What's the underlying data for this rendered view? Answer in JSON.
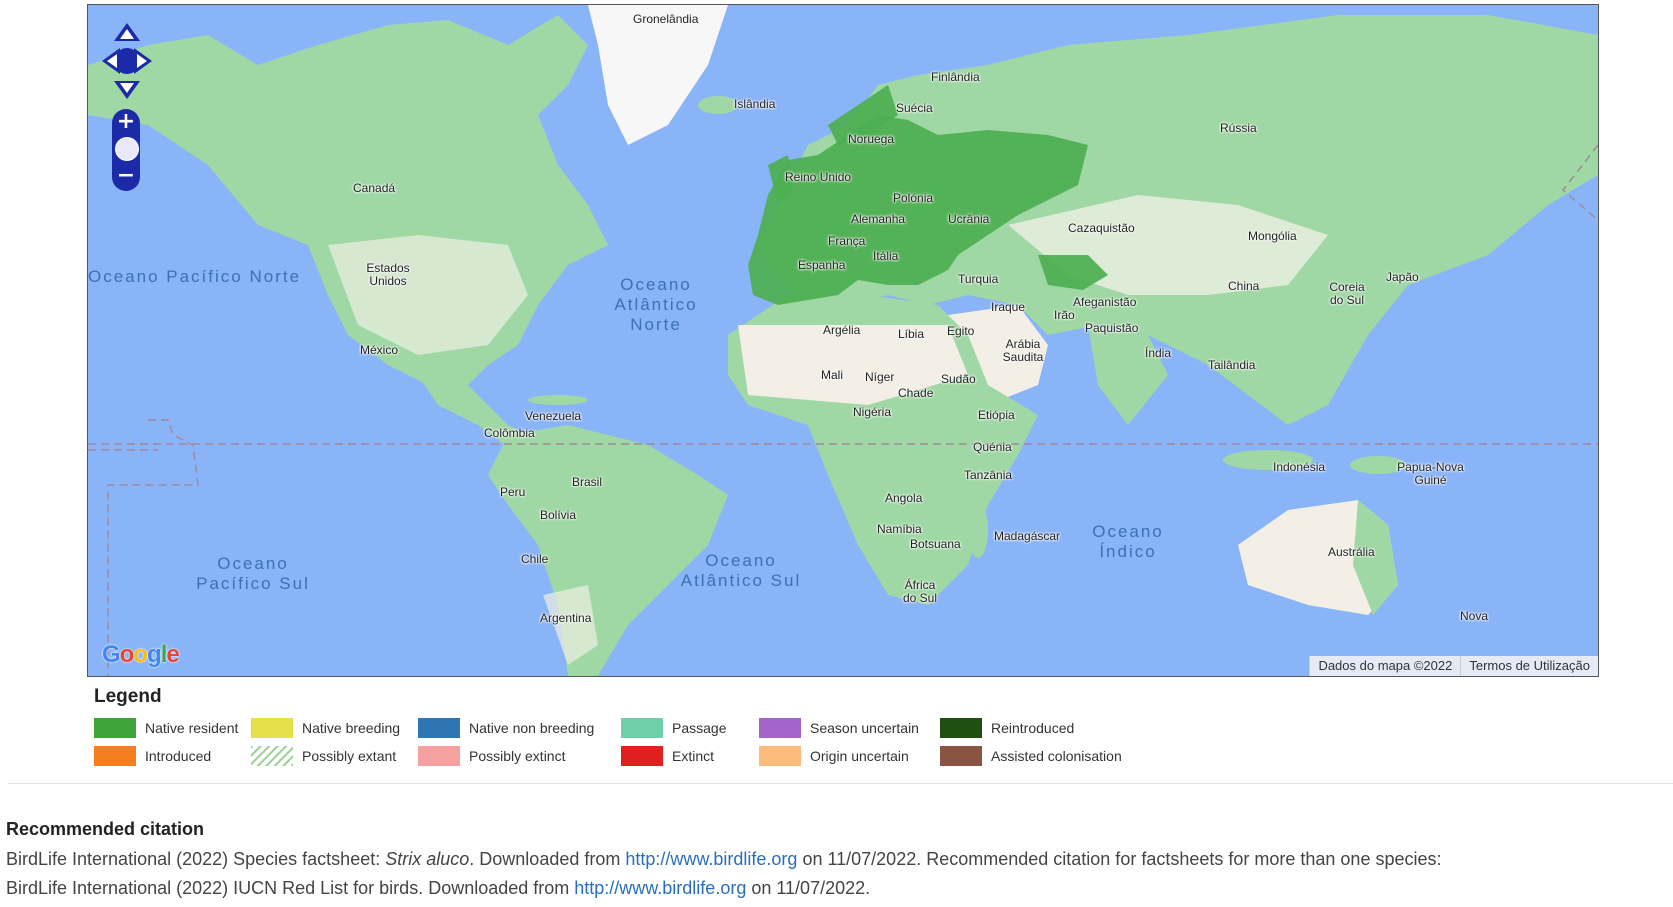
{
  "map": {
    "countries": [
      {
        "name": "Gronelândia"
      },
      {
        "name": "Islândia"
      },
      {
        "name": "Finlândia"
      },
      {
        "name": "Suécia"
      },
      {
        "name": "Noruega"
      },
      {
        "name": "Rússia"
      },
      {
        "name": "Reino Unido"
      },
      {
        "name": "Polónia"
      },
      {
        "name": "Alemanha"
      },
      {
        "name": "Ucrânia"
      },
      {
        "name": "França"
      },
      {
        "name": "Espanha"
      },
      {
        "name": "Itália"
      },
      {
        "name": "Turquia"
      },
      {
        "name": "Cazaquistão"
      },
      {
        "name": "Mongólia"
      },
      {
        "name": "Iraque"
      },
      {
        "name": "Irão"
      },
      {
        "name": "Afeganistão"
      },
      {
        "name": "Paquistão"
      },
      {
        "name": "China"
      },
      {
        "name": "Coreia do Sul"
      },
      {
        "name": "Japão"
      },
      {
        "name": "Arábia Saudita"
      },
      {
        "name": "Índia"
      },
      {
        "name": "Tailândia"
      },
      {
        "name": "Argélia"
      },
      {
        "name": "Líbia"
      },
      {
        "name": "Egito"
      },
      {
        "name": "Mali"
      },
      {
        "name": "Níger"
      },
      {
        "name": "Chade"
      },
      {
        "name": "Sudão"
      },
      {
        "name": "Nigéria"
      },
      {
        "name": "Etiópia"
      },
      {
        "name": "Quénia"
      },
      {
        "name": "Tanzânia"
      },
      {
        "name": "Angola"
      },
      {
        "name": "Namíbia"
      },
      {
        "name": "Botsuana"
      },
      {
        "name": "Madagáscar"
      },
      {
        "name": "África do Sul"
      },
      {
        "name": "Indonésia"
      },
      {
        "name": "Papua-Nova Guiné"
      },
      {
        "name": "Austrália"
      },
      {
        "name": "Canadá"
      },
      {
        "name": "Estados Unidos"
      },
      {
        "name": "México"
      },
      {
        "name": "Venezuela"
      },
      {
        "name": "Colômbia"
      },
      {
        "name": "Brasil"
      },
      {
        "name": "Peru"
      },
      {
        "name": "Bolívia"
      },
      {
        "name": "Chile"
      },
      {
        "name": "Argentina"
      },
      {
        "name": "Nova"
      }
    ],
    "oceans": [
      {
        "name": "Oceano Pacífico Norte"
      },
      {
        "name": "Oceano Atlântico Norte"
      },
      {
        "name": "Oceano Pacífico Sul"
      },
      {
        "name": "Oceano Atlântico Sul"
      },
      {
        "name": "Oceano Índico"
      }
    ],
    "attribution": {
      "data": "Dados do mapa ©2022",
      "terms": "Termos de Utilização"
    },
    "logo": "Google",
    "colors": {
      "water": "#8ab4f8",
      "land": "#9fd8a4",
      "desert": "#f3efe6",
      "range": "#4caf50"
    }
  },
  "legend": {
    "title": "Legend",
    "items": [
      {
        "label": "Native resident",
        "color": "#3ea53a"
      },
      {
        "label": "Native breeding",
        "color": "#e5e14a"
      },
      {
        "label": "Native non breeding",
        "color": "#2d76b3"
      },
      {
        "label": "Passage",
        "color": "#6fcfa8"
      },
      {
        "label": "Season uncertain",
        "color": "#a265c9"
      },
      {
        "label": "Reintroduced",
        "color": "#1e4e10"
      },
      {
        "label": "Introduced",
        "color": "#f57f20"
      },
      {
        "label": "Possibly extant",
        "color": "hatch"
      },
      {
        "label": "Possibly extinct",
        "color": "#f6a0a0"
      },
      {
        "label": "Extinct",
        "color": "#e01f1f"
      },
      {
        "label": "Origin uncertain",
        "color": "#fdbc7c"
      },
      {
        "label": "Assisted colonisation",
        "color": "#8a5443"
      }
    ]
  },
  "citation": {
    "heading": "Recommended citation",
    "line1_a": "BirdLife International (2022) Species factsheet: ",
    "line1_species": "Strix aluco",
    "line1_b": ". Downloaded from ",
    "link": "http://www.birdlife.org",
    "line1_c": " on 11/07/2022. Recommended citation for factsheets for more than one species:",
    "line2_a": "BirdLife International (2022) IUCN Red List for birds. Downloaded from ",
    "line2_c": " on 11/07/2022."
  }
}
